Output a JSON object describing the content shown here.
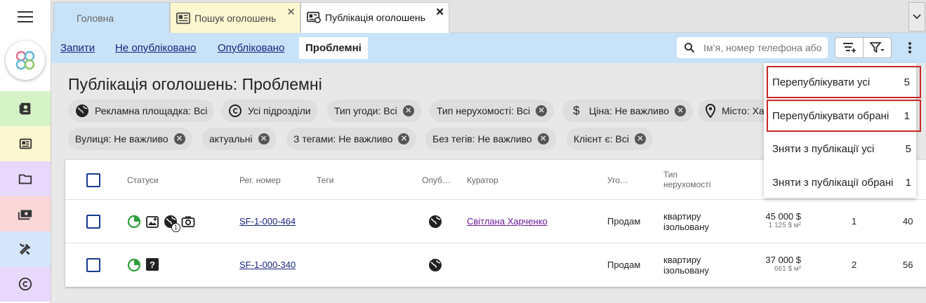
{
  "tabs": {
    "home": "Головна",
    "search": "Пошук оголошень",
    "publication": "Публікація оголошень"
  },
  "subnav": {
    "requests": "Запити",
    "unpublished": "Не опубліковано",
    "published": "Опубліковано",
    "problematic": "Проблемні"
  },
  "search": {
    "placeholder": "Ім’я, номер телефона або"
  },
  "page_title": "Публікація оголошень: Проблемні",
  "chips": [
    "Рекламна площадка: Всі",
    "Усі підрозділи",
    "Тип угоди: Всі",
    "Тип нерухомості: Всі",
    "Ціна: Не важливо",
    "Місто: Ха",
    "Вулиця: Не важливо",
    "актуальні",
    "З тегами: Не важливо",
    "Без тегів: Не важливо",
    "Клієнт є: Всі"
  ],
  "table": {
    "headers": {
      "statuses": "Статуси",
      "reg": "Рег. номер",
      "tags": "Теги",
      "published": "Опуб…",
      "curator": "Куратор",
      "deal": "Уго…",
      "type_line1": "Тип",
      "type_line2": "нерухомості"
    },
    "rows": [
      {
        "reg": "SF-1-000-464",
        "curator": "Світлана Харченко",
        "deal": "Продам",
        "type1": "квартиру",
        "type2": "ізольовану",
        "price": "45 000 $",
        "price_m2": "1 125 $ м²",
        "n1": "1",
        "n2": "40",
        "badge": "1"
      },
      {
        "reg": "SF-1-000-340",
        "curator": "",
        "deal": "Продам",
        "type1": "квартиру",
        "type2": "ізольовану",
        "price": "37 000 $",
        "price_m2": "661 $ м²",
        "n1": "2",
        "n2": "56"
      }
    ]
  },
  "dropdown": [
    {
      "label": "Перепублікувати усі",
      "count": "5"
    },
    {
      "label": "Перепублікувати обрані",
      "count": "1"
    },
    {
      "label": "Зняти з публікації усі",
      "count": "5"
    },
    {
      "label": "Зняти з публікації обрані",
      "count": "1"
    }
  ],
  "colors": {
    "subnav_bg": "#c8e2f7",
    "search_tab_bg": "#fbf7d0",
    "highlight": "#c62828",
    "link": "#1a237e",
    "status_green": "#2e9e3a"
  }
}
